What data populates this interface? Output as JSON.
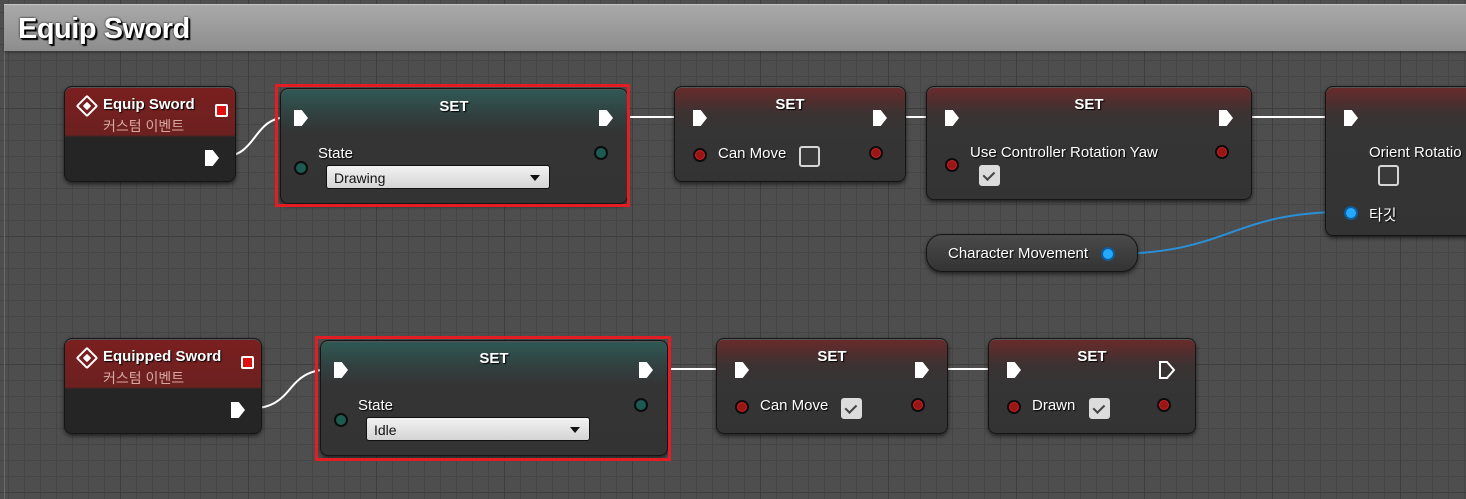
{
  "comment": {
    "title": "Equip Sword"
  },
  "row1": {
    "event": {
      "title": "Equip Sword",
      "subtitle": "커스텀 이벤트"
    },
    "set_state": {
      "title": "SET",
      "pin_label": "State",
      "value": "Drawing"
    },
    "set_can_move": {
      "title": "SET",
      "pin_label": "Can Move",
      "checked": false
    },
    "set_use_controller": {
      "title": "SET",
      "pin_label": "Use Controller Rotation Yaw",
      "checked": true
    },
    "set_orient": {
      "title": "SET",
      "pin_label": "Orient Rotatio",
      "checked": false,
      "target_label": "타깃"
    },
    "character_movement": {
      "label": "Character Movement"
    }
  },
  "row2": {
    "event": {
      "title": "Equipped Sword",
      "subtitle": "커스텀 이벤트"
    },
    "set_state": {
      "title": "SET",
      "pin_label": "State",
      "value": "Idle"
    },
    "set_can_move": {
      "title": "SET",
      "pin_label": "Can Move",
      "checked": true
    },
    "set_drawn": {
      "title": "SET",
      "pin_label": "Drawn",
      "checked": true
    }
  },
  "colors": {
    "highlight": "#e21e24",
    "bool_pin": "#9a1616",
    "enum_pin": "#1c5a52",
    "object_pin": "#25a8ff",
    "wire_exec": "#ffffff",
    "wire_object": "#2b8fd6"
  },
  "icons": [
    "event-diamond-icon",
    "exec-pin-icon",
    "checkbox-icon",
    "dropdown-caret-icon"
  ]
}
